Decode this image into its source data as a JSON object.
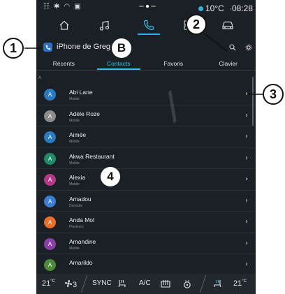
{
  "status": {
    "temperature": "10°C",
    "time": "08:28",
    "dot_separator": "·"
  },
  "nav": {
    "items": [
      "home-icon",
      "music-icon",
      "phone-icon",
      "apps-icon",
      "car-icon"
    ],
    "active": "phone-icon"
  },
  "phone": {
    "device_name": "iPhone de Greg"
  },
  "tabs": [
    {
      "label": "Récents"
    },
    {
      "label": "Contacts"
    },
    {
      "label": "Favoris"
    },
    {
      "label": "Clavier"
    }
  ],
  "section_letter": "A",
  "contacts": [
    {
      "initial": "A",
      "name": "Abi Lane",
      "sub": "Mobile",
      "color": "#2a7bc0"
    },
    {
      "initial": "A",
      "name": "Adèle Roze",
      "sub": "Mobile",
      "color": "#8c8c8c"
    },
    {
      "initial": "A",
      "name": "Aimée",
      "sub": "Mobile",
      "color": "#2a7bc0"
    },
    {
      "initial": "A",
      "name": "Akwa Restaurant",
      "sub": "Mobile",
      "color": "#1f8b6a"
    },
    {
      "initial": "A",
      "name": "Alexia",
      "sub": "Mobile",
      "color": "#b03a88"
    },
    {
      "initial": "A",
      "name": "Amadou",
      "sub": "Domicile",
      "color": "#3b7fd0"
    },
    {
      "initial": "A",
      "name": "Anda Mol",
      "sub": "Plusieurs",
      "color": "#e8702a"
    },
    {
      "initial": "A",
      "name": "Amandine",
      "sub": "Mobile",
      "color": "#8a3ea8"
    },
    {
      "initial": "A",
      "name": "Amarildo",
      "sub": "",
      "color": "#4a8a3a"
    }
  ],
  "climate": {
    "left_temp": "21",
    "left_unit": "°C",
    "fan_level": "3",
    "sync_label": "SYNC",
    "ac_label": "A/C",
    "right_temp": "21",
    "right_unit": "°C"
  },
  "callouts": {
    "c1": "1",
    "c2": "2",
    "c3": "3",
    "c4": "4",
    "cB": "B"
  },
  "colors": {
    "accent": "#36c0e8",
    "screen_bg": "#1b1f26"
  }
}
